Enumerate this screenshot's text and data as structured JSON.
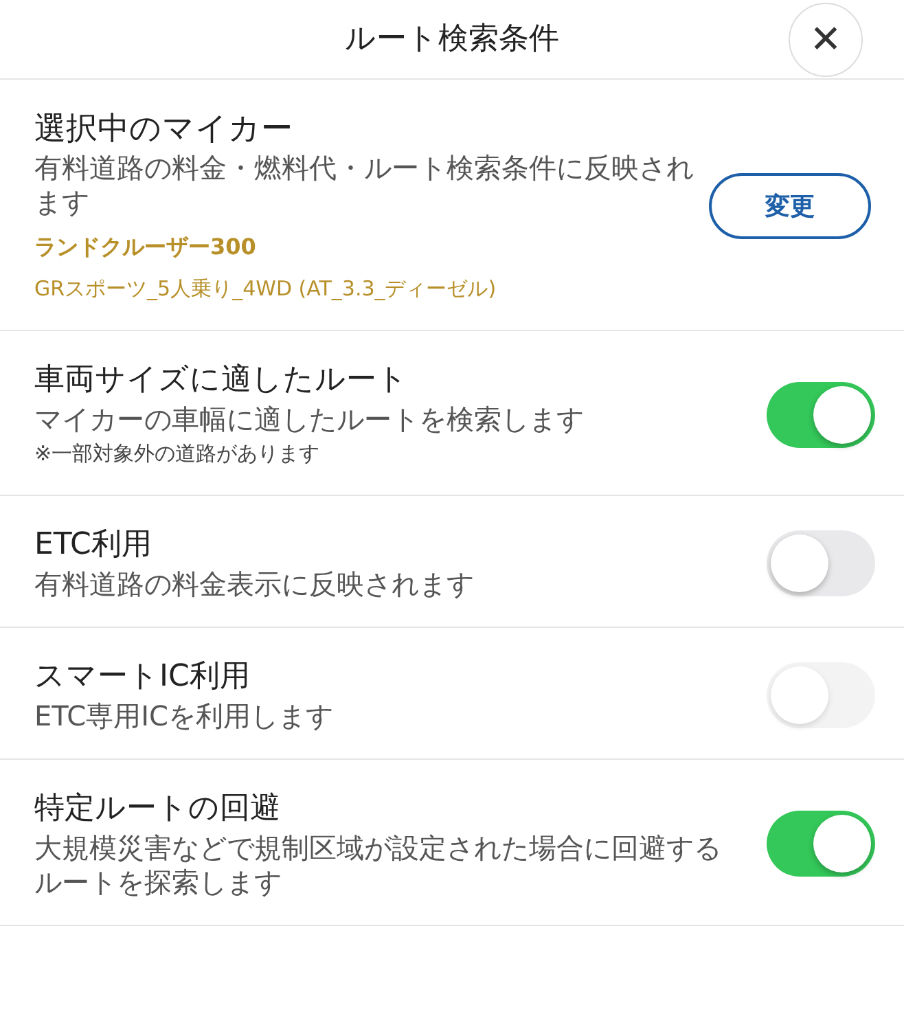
{
  "header": {
    "title": "ルート検索条件",
    "close_label": "✕"
  },
  "car": {
    "title": "選択中のマイカー",
    "description": "有料道路の料金・燃料代・ルート検索条件に反映されます",
    "model": "ランドクルーザー300",
    "grade": "GRスポーツ_5人乗り_4WD (AT_3.3_ディーゼル)",
    "button": "変更"
  },
  "settings": [
    {
      "title": "車両サイズに適したルート",
      "description": "マイカーの車幅に適したルートを検索します",
      "note": "※一部対象外の道路があります",
      "on": true,
      "disabled": false
    },
    {
      "title": "ETC利用",
      "description": "有料道路の料金表示に反映されます",
      "on": false,
      "disabled": false
    },
    {
      "title": "スマートIC利用",
      "description": "ETC専用ICを利用します",
      "on": false,
      "disabled": true
    },
    {
      "title": "特定ルートの回避",
      "description": "大規模災害などで規制区域が設定された場合に回避するルートを探索します",
      "on": true,
      "disabled": false
    }
  ]
}
